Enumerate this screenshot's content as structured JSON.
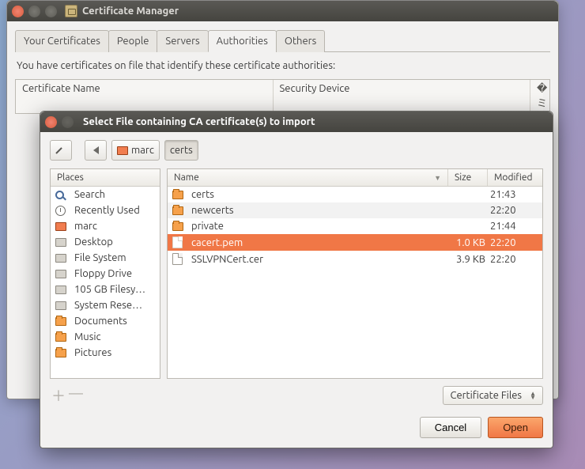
{
  "parent": {
    "title": "Certificate Manager",
    "tabs": [
      "Your Certificates",
      "People",
      "Servers",
      "Authorities",
      "Others"
    ],
    "active_tab_index": 3,
    "info": "You have certificates on file that identify these certificate authorities:",
    "columns": {
      "name": "Certificate Name",
      "device": "Security Device",
      "opt": "�ミ"
    }
  },
  "dialog": {
    "title": "Select File containing CA certificate(s) to import",
    "path": {
      "user": "marc",
      "folder": "certs"
    },
    "places_header": "Places",
    "places": [
      {
        "icon": "search",
        "label": "Search"
      },
      {
        "icon": "clock",
        "label": "Recently Used"
      },
      {
        "icon": "home",
        "label": "marc"
      },
      {
        "icon": "drive",
        "label": "Desktop"
      },
      {
        "icon": "drive",
        "label": "File System"
      },
      {
        "icon": "drive",
        "label": "Floppy Drive"
      },
      {
        "icon": "drive",
        "label": "105 GB Filesy…"
      },
      {
        "icon": "drive",
        "label": "System Rese…"
      },
      {
        "icon": "folder",
        "label": "Documents"
      },
      {
        "icon": "folder",
        "label": "Music"
      },
      {
        "icon": "folder",
        "label": "Pictures"
      }
    ],
    "file_headers": {
      "name": "Name",
      "size": "Size",
      "modified": "Modified"
    },
    "files": [
      {
        "icon": "folder",
        "name": "certs",
        "size": "",
        "modified": "21:43",
        "selected": false
      },
      {
        "icon": "folder",
        "name": "newcerts",
        "size": "",
        "modified": "22:20",
        "selected": false
      },
      {
        "icon": "folder",
        "name": "private",
        "size": "",
        "modified": "21:44",
        "selected": false
      },
      {
        "icon": "file",
        "name": "cacert.pem",
        "size": "1.0 KB",
        "modified": "22:20",
        "selected": true
      },
      {
        "icon": "file",
        "name": "SSLVPNCert.cer",
        "size": "3.9 KB",
        "modified": "22:20",
        "selected": false
      }
    ],
    "filter_label": "Certificate Files",
    "buttons": {
      "cancel": "Cancel",
      "open": "Open"
    },
    "sort_indicator": "▼"
  }
}
